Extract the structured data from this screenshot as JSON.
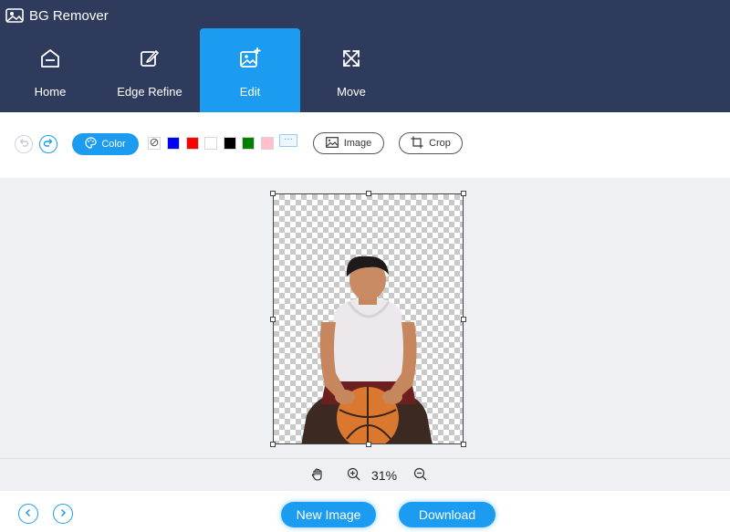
{
  "app": {
    "title": "BG Remover"
  },
  "nav": {
    "tabs": [
      {
        "label": "Home"
      },
      {
        "label": "Edge Refine"
      },
      {
        "label": "Edit"
      },
      {
        "label": "Move"
      }
    ],
    "active_tab": "Edit"
  },
  "toolbar": {
    "color_label": "Color",
    "swatches": [
      "none",
      "#0000ff",
      "#ff0000",
      "#ffffff",
      "#000000",
      "#008000",
      "#ffc0cb"
    ],
    "more_label": "···",
    "image_label": "Image",
    "crop_label": "Crop"
  },
  "zoom": {
    "label": "31%"
  },
  "footer": {
    "new_image_label": "New Image",
    "download_label": "Download"
  },
  "colors": {
    "header": "#2f3b5c",
    "accent": "#1b9cf0",
    "canvas_bg": "#eef0f3"
  }
}
